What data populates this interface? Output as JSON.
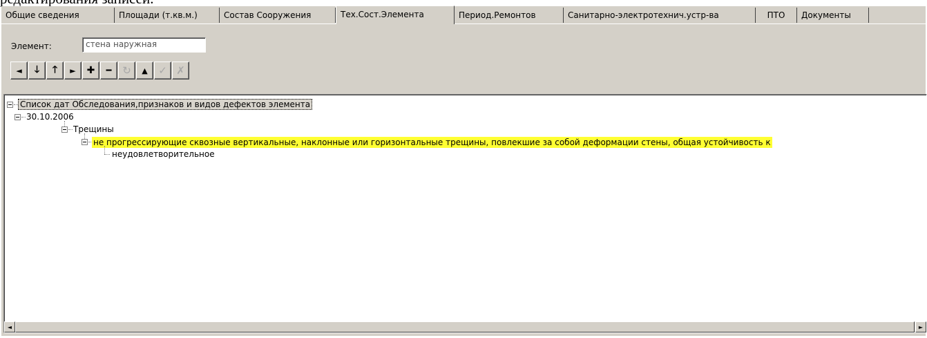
{
  "document_text": "редактирования записей.",
  "tabs": [
    {
      "label": "Общие сведения",
      "active": false
    },
    {
      "label": "Площади (т.кв.м.)",
      "active": false
    },
    {
      "label": "Состав Сооружения",
      "active": false
    },
    {
      "label": "Тех.Сост.Элемента",
      "active": true
    },
    {
      "label": "Период.Ремонтов",
      "active": false
    },
    {
      "label": "Санитарно-электротехнич.устр-ва",
      "active": false
    },
    {
      "label": "ПТО",
      "active": false
    },
    {
      "label": "Документы",
      "active": false
    }
  ],
  "element_field": {
    "label": "Элемент:",
    "value": "стена наружная"
  },
  "toolbar": [
    {
      "icon": "arrow-left-icon",
      "glyph": "◄",
      "enabled": true
    },
    {
      "icon": "arrow-down-icon",
      "glyph": "🡓",
      "enabled": true
    },
    {
      "icon": "arrow-up-icon",
      "glyph": "🡑",
      "enabled": true
    },
    {
      "icon": "arrow-right-icon",
      "glyph": "►",
      "enabled": true
    },
    {
      "icon": "plus-icon",
      "glyph": "✚",
      "enabled": true
    },
    {
      "icon": "minus-icon",
      "glyph": "━",
      "enabled": true
    },
    {
      "icon": "refresh-icon",
      "glyph": "↻",
      "enabled": false
    },
    {
      "icon": "triangle-up-icon",
      "glyph": "▲",
      "enabled": true
    },
    {
      "icon": "checkmark-icon",
      "glyph": "✓",
      "enabled": false
    },
    {
      "icon": "cancel-icon",
      "glyph": "✗",
      "enabled": false
    }
  ],
  "tree": {
    "root": "Список дат Обследования,признаков и видов дефектов элемента",
    "date": "30.10.2006",
    "category": "Трещины",
    "defect": "не прогрессирующие сквозные вертикальные, наклонные или горизонтальные трещины, повлекшие за собой деформации стены, общая устойчивость к",
    "assessment": "неудовлетворительное"
  },
  "colors": {
    "window_bg": "#d4d0c8",
    "highlight_yellow": "#ffff33"
  }
}
